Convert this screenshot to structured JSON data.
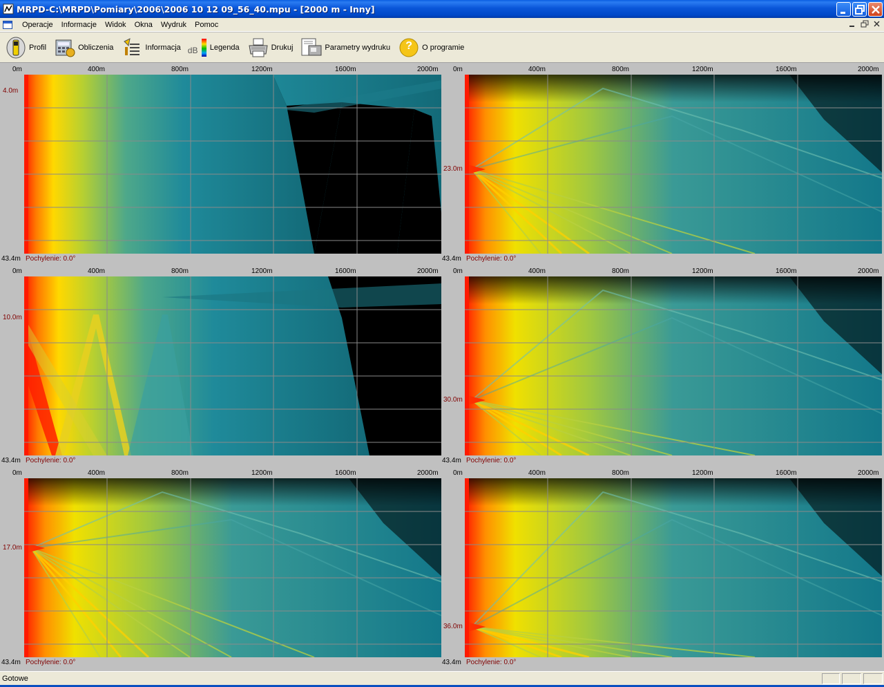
{
  "window": {
    "title": "MRPD-C:\\MRPD\\Pomiary\\2006\\2006 10 12 09_56_40.mpu - [2000 m - Inny]"
  },
  "menu": {
    "items": [
      {
        "label": "Operacje"
      },
      {
        "label": "Informacje"
      },
      {
        "label": "Widok"
      },
      {
        "label": "Okna"
      },
      {
        "label": "Wydruk"
      },
      {
        "label": "Pomoc"
      }
    ]
  },
  "toolbar": {
    "buttons": [
      {
        "label": "Profil",
        "icon": "profile-icon"
      },
      {
        "label": "Obliczenia",
        "icon": "calculator-icon"
      },
      {
        "label": "Informacja",
        "icon": "info-list-icon"
      },
      {
        "label": "Legenda",
        "icon": "legend-icon",
        "icon_text": "dB"
      },
      {
        "label": "Drukuj",
        "icon": "printer-icon"
      },
      {
        "label": "Parametry wydruku",
        "icon": "print-settings-icon"
      },
      {
        "label": "O programie",
        "icon": "help-icon",
        "icon_text": "?"
      }
    ]
  },
  "x_ticks": [
    "0m",
    "400m",
    "800m",
    "1200m",
    "1600m",
    "2000m"
  ],
  "panels": [
    {
      "depth_label": "4.0m",
      "bottom_label": "43.4m",
      "tilt_label": "Pochylenie: 0.0°"
    },
    {
      "depth_label": "23.0m",
      "bottom_label": "43.4m",
      "tilt_label": "Pochylenie: 0.0°"
    },
    {
      "depth_label": "10.0m",
      "bottom_label": "43.4m",
      "tilt_label": "Pochylenie: 0.0°"
    },
    {
      "depth_label": "30.0m",
      "bottom_label": "43.4m",
      "tilt_label": "Pochylenie: 0.0°"
    },
    {
      "depth_label": "17.0m",
      "bottom_label": "43.4m",
      "tilt_label": "Pochylenie: 0.0°"
    },
    {
      "depth_label": "36.0m",
      "bottom_label": "43.4m",
      "tilt_label": "Pochylenie: 0.0°"
    }
  ],
  "status": {
    "text": "Gotowe"
  },
  "colors": {
    "titlebar": "#0a56d8",
    "chrome": "#ece9d8",
    "field_high": "#ff0000",
    "field_mid": "#f0e000",
    "field_low": "#1a7a8a"
  }
}
